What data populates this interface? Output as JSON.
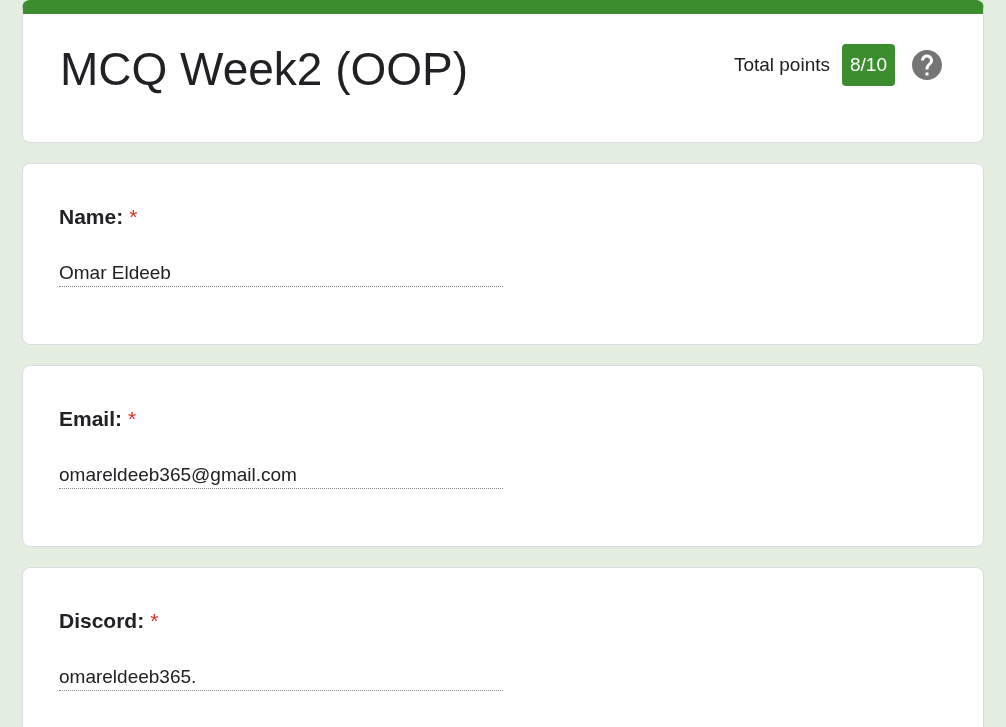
{
  "header": {
    "title": "MCQ Week2 (OOP)",
    "total_points_label": "Total points",
    "score": "8/10"
  },
  "questions": [
    {
      "label": "Name:",
      "required_mark": "*",
      "answer": "Omar Eldeeb"
    },
    {
      "label": "Email:",
      "required_mark": "*",
      "answer": "omareldeeb365@gmail.com"
    },
    {
      "label": "Discord:",
      "required_mark": "*",
      "answer": "omareldeeb365."
    }
  ]
}
